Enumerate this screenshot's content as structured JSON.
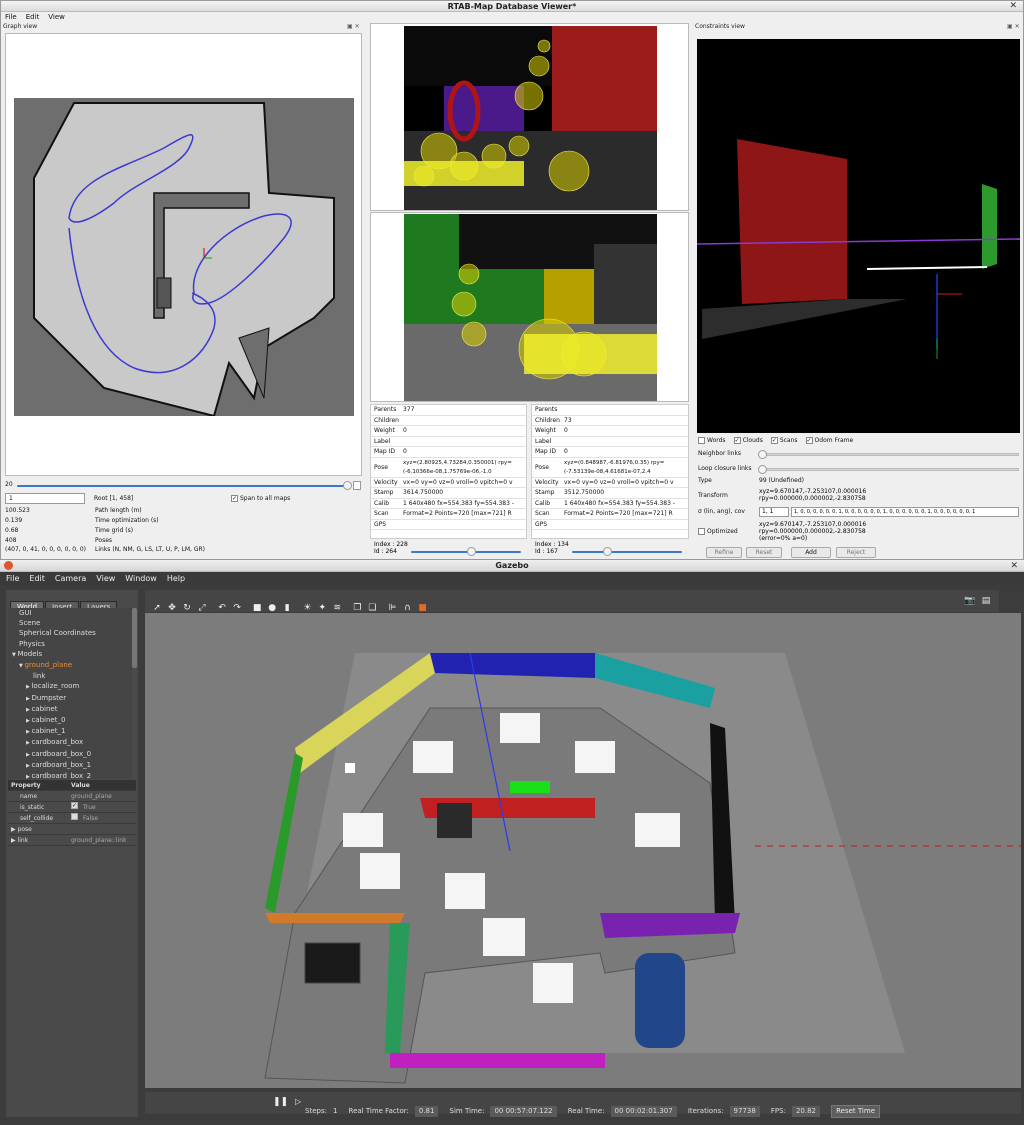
{
  "rtab": {
    "title": "RTAB-Map Database Viewer*",
    "menu": [
      "File",
      "Edit",
      "View"
    ],
    "graph_view": {
      "title": "Graph view",
      "slider_value": "20",
      "root_input": "1",
      "root_label": "Root [1, 458]",
      "span_label": "Span to all maps",
      "stats": [
        {
          "value": "100.523",
          "label": "Path length (m)"
        },
        {
          "value": "0.139",
          "label": "Time optimization (s)"
        },
        {
          "value": "0.68",
          "label": "Time grid (s)"
        },
        {
          "value": "408",
          "label": "Poses"
        },
        {
          "value": "(407, 0, 41, 0, 0, 0, 0, 0, 0)",
          "label": "Links (N, NM, G, LS, LT, U, P, LM, GR)"
        }
      ]
    },
    "node_a": {
      "rows": [
        {
          "k": "Parents",
          "v": "377"
        },
        {
          "k": "Children",
          "v": ""
        },
        {
          "k": "Weight",
          "v": "0"
        },
        {
          "k": "Label",
          "v": ""
        },
        {
          "k": "Map ID",
          "v": "0"
        },
        {
          "k": "Pose",
          "v": "xyz=(2.80925,4.73284,0.350001) rpy=(-6.10366e-08,1.75769e-06,-1.0"
        },
        {
          "k": "Velocity",
          "v": "vx=0 vy=0 vz=0 vroll=0 vpitch=0 v"
        },
        {
          "k": "Stamp",
          "v": "3614.750000"
        },
        {
          "k": "Calib",
          "v": "1 640x480 fx=554.383 fy=554.383 -"
        },
        {
          "k": "Scan",
          "v": "Format=2 Points=720 [max=721] R"
        },
        {
          "k": "GPS",
          "v": ""
        }
      ],
      "index": "Index : 228",
      "id": "Id :",
      "id_value": "264"
    },
    "node_b": {
      "rows": [
        {
          "k": "Parents",
          "v": ""
        },
        {
          "k": "Children",
          "v": "73"
        },
        {
          "k": "Weight",
          "v": "0"
        },
        {
          "k": "Label",
          "v": ""
        },
        {
          "k": "Map ID",
          "v": "0"
        },
        {
          "k": "Pose",
          "v": "xyz=(0.848987,-6.81976,0.35) rpy=(-7.53139e-08,4.61681e-07,2.4"
        },
        {
          "k": "Velocity",
          "v": "vx=0 vy=0 vz=0 vroll=0 vpitch=0 v"
        },
        {
          "k": "Stamp",
          "v": "3512.750000"
        },
        {
          "k": "Calib",
          "v": "1 640x480 fx=554.383 fy=554.383 -"
        },
        {
          "k": "Scan",
          "v": "Format=2 Points=720 [max=721] R"
        },
        {
          "k": "GPS",
          "v": ""
        }
      ],
      "index": "Index : 134",
      "id": "Id :",
      "id_value": "167"
    },
    "constraints": {
      "title": "Constraints view",
      "checks": [
        {
          "label": "Words",
          "checked": false
        },
        {
          "label": "Clouds",
          "checked": true
        },
        {
          "label": "Scans",
          "checked": true
        },
        {
          "label": "Odom Frame",
          "checked": true
        }
      ],
      "neighbor_label": "Neighbor links",
      "loop_label": "Loop closure links",
      "type_label": "Type",
      "type_value": "99  (Undefined)",
      "transform_label": "Transform",
      "transform_value_1": "xyz=9.670147,-7.253107,0.000016",
      "transform_value_2": "rpy=0.000000,0.000002,-2.830758",
      "cov_label": "σ (lin, ang), cov",
      "cov_a": "1, 1",
      "cov_b": "1, 0, 0, 0, 0, 0, 0, 1, 0, 0, 0, 0, 0, 0, 1, 0, 0, 0, 0, 0, 0, 1, 0, 0, 0, 0, 0, 0, 1",
      "optimized_label": "Optimized",
      "optimized_value_1": "xyz=9.670147,-7.253107,0.000016",
      "optimized_value_2": "rpy=0.000000,0.000002,-2.830758",
      "optimized_value_3": "(error=0% a=0)",
      "buttons": [
        "Refine",
        "Reset",
        "Add",
        "Reject"
      ]
    }
  },
  "gazebo": {
    "title": "Gazebo",
    "menu": [
      "File",
      "Edit",
      "Camera",
      "View",
      "Window",
      "Help"
    ],
    "tabs": [
      "World",
      "Insert",
      "Layers"
    ],
    "tree": [
      {
        "label": "GUI",
        "indent": 1,
        "arrow": ""
      },
      {
        "label": "Scene",
        "indent": 1,
        "arrow": ""
      },
      {
        "label": "Spherical Coordinates",
        "indent": 1,
        "arrow": ""
      },
      {
        "label": "Physics",
        "indent": 1,
        "arrow": ""
      },
      {
        "label": "Models",
        "indent": 0,
        "arrow": "▼"
      },
      {
        "label": "ground_plane",
        "indent": 1,
        "arrow": "▼",
        "selected": true
      },
      {
        "label": "link",
        "indent": 3,
        "arrow": ""
      },
      {
        "label": "localize_room",
        "indent": 2,
        "arrow": "▶"
      },
      {
        "label": "Dumpster",
        "indent": 2,
        "arrow": "▶"
      },
      {
        "label": "cabinet",
        "indent": 2,
        "arrow": "▶"
      },
      {
        "label": "cabinet_0",
        "indent": 2,
        "arrow": "▶"
      },
      {
        "label": "cabinet_1",
        "indent": 2,
        "arrow": "▶"
      },
      {
        "label": "cardboard_box",
        "indent": 2,
        "arrow": "▶"
      },
      {
        "label": "cardboard_box_0",
        "indent": 2,
        "arrow": "▶"
      },
      {
        "label": "cardboard_box_1",
        "indent": 2,
        "arrow": "▶"
      },
      {
        "label": "cardboard_box_2",
        "indent": 2,
        "arrow": "▶"
      },
      {
        "label": "cardboard_box_3",
        "indent": 2,
        "arrow": "▶"
      }
    ],
    "prop_headers": [
      "Property",
      "Value"
    ],
    "props": [
      {
        "k": "name",
        "v": "ground_plane"
      },
      {
        "k": "is_static",
        "v": "True",
        "check": true
      },
      {
        "k": "self_collide",
        "v": "False",
        "check": true
      },
      {
        "k": "pose",
        "v": "",
        "arrow": true
      },
      {
        "k": "link",
        "v": "ground_plane::link",
        "arrow": true
      }
    ],
    "status": {
      "steps_label": "Steps:",
      "steps_value": "1",
      "rtf_label": "Real Time Factor:",
      "rtf_value": "0.81",
      "sim_label": "Sim Time:",
      "sim_value": "00 00:57:07.122",
      "real_label": "Real Time:",
      "real_value": "00 00:02:01.307",
      "iter_label": "Iterations:",
      "iter_value": "97738",
      "fps_label": "FPS:",
      "fps_value": "20.82",
      "reset_label": "Reset Time"
    }
  }
}
